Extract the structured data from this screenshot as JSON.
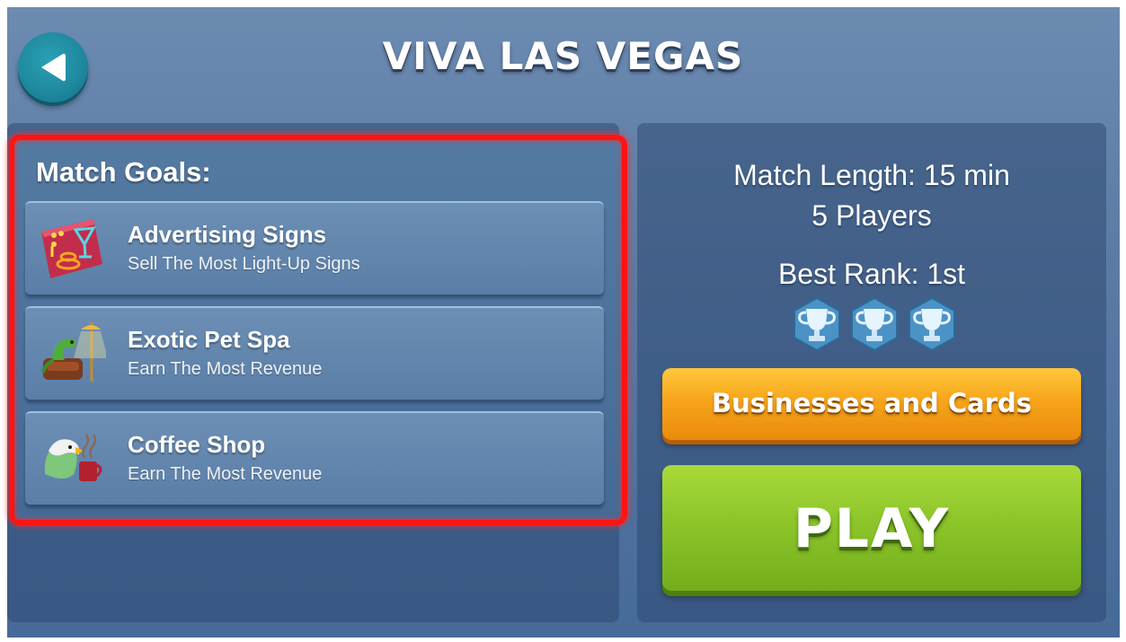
{
  "header": {
    "title": "VIVA LAS VEGAS",
    "back_icon": "back-arrow-icon"
  },
  "goals": {
    "heading": "Match Goals:",
    "items": [
      {
        "title": "Advertising Signs",
        "subtitle": "Sell The Most Light-Up Signs",
        "icon": "advertising-signs-icon"
      },
      {
        "title": "Exotic Pet Spa",
        "subtitle": "Earn The Most Revenue",
        "icon": "exotic-pet-spa-icon"
      },
      {
        "title": "Coffee Shop",
        "subtitle": "Earn The Most Revenue",
        "icon": "coffee-shop-icon"
      }
    ],
    "highlight_color": "#ff1414"
  },
  "match_info": {
    "length": "Match Length: 15 min",
    "players": "5 Players",
    "best_rank": "Best Rank: 1st",
    "trophy_count": 3
  },
  "buttons": {
    "businesses_cards": "Businesses and Cards",
    "play": "PLAY"
  },
  "colors": {
    "orange_button": "#f7a51b",
    "green_button": "#8cc62a",
    "back_button": "#1f8aa0"
  }
}
